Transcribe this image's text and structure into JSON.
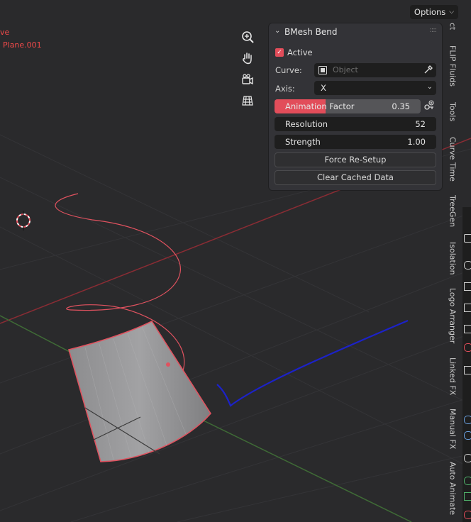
{
  "viewport": {
    "object_labels": [
      "ve",
      "Plane.001"
    ],
    "options_label": "Options",
    "nav_buttons": [
      "zoom-icon",
      "hand-pan-icon",
      "camera-icon",
      "grid-perspective-icon"
    ]
  },
  "panel": {
    "title": "BMesh Bend",
    "active_label": "Active",
    "active_checked": true,
    "curve_label": "Curve:",
    "curve_placeholder": "Object",
    "axis_label": "Axis:",
    "axis_value": "X",
    "animation_factor": {
      "label": "Animation Factor",
      "value": "0.35",
      "fraction": 0.35
    },
    "resolution": {
      "label": "Resolution",
      "value": "52"
    },
    "strength": {
      "label": "Strength",
      "value": "1.00"
    },
    "force_resetup_label": "Force Re-Setup",
    "clear_cache_label": "Clear Cached Data"
  },
  "sidebar_tabs": [
    "ct",
    "FLIP Fluids",
    "Tools",
    "Curve Time",
    "TreeGen",
    "Isolation",
    "Logo Arranger",
    "Linked FX",
    "Manual FX",
    "Auto Animate"
  ],
  "colors": {
    "accent": "#e24d5a",
    "viewport_bg": "#2a2a2c",
    "panel_bg": "#333337",
    "x_axis": "#8a2c34",
    "y_axis": "#3f6b36",
    "annotation_blue": "#1c22c9"
  }
}
